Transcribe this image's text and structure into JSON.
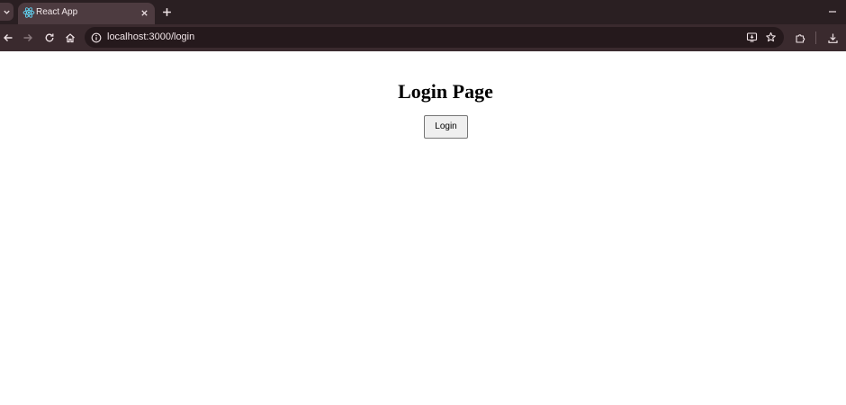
{
  "browser": {
    "tab": {
      "title": "React App",
      "favicon": "react-logo-icon"
    },
    "address_bar": {
      "url": "localhost:3000/login"
    },
    "icons": {
      "tab_list": "chevron-down-icon",
      "tab_close": "close-icon",
      "new_tab": "plus-icon",
      "minimize": "minimize-icon",
      "back": "back-arrow-icon",
      "forward": "forward-arrow-icon",
      "reload": "reload-icon",
      "home": "home-icon",
      "site_info": "info-icon",
      "install_app": "install-app-icon",
      "bookmark": "star-icon",
      "extensions": "puzzle-icon",
      "downloads": "download-icon"
    },
    "colors": {
      "tab_strip": "#2a1f22",
      "toolbar": "#3a2a2e",
      "active_tab": "#4d3b40",
      "omnibox": "#25191c",
      "react_blue": "#61dafb"
    }
  },
  "page": {
    "title": "Login Page",
    "login_button": "Login"
  }
}
